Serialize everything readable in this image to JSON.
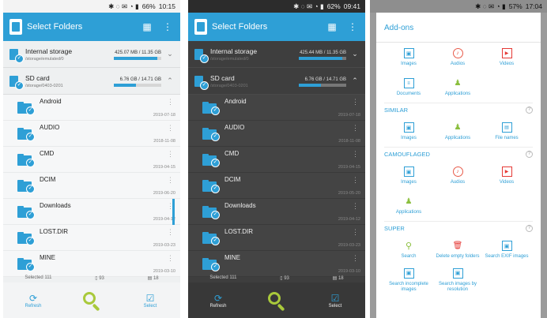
{
  "screen1": {
    "status": {
      "icons": "✱ ◌ ✉ ◔ ▮",
      "battery": "66%",
      "time": "10:15"
    },
    "toolbar": {
      "title": "Select Folders"
    },
    "storages": [
      {
        "name": "Internal storage",
        "path": "/storage/emulated/0",
        "size": "425.07 MB / 11.35 GB",
        "fill": 0.92,
        "chevron": "⌄"
      },
      {
        "name": "SD card",
        "path": "/storage/0403-0201",
        "size": "6.76 GB / 14.71 GB",
        "fill": 0.46,
        "chevron": "⌃"
      }
    ],
    "folders": [
      {
        "name": "Android",
        "date": "2019-07-18"
      },
      {
        "name": "AUDIO",
        "date": "2018-11-08"
      },
      {
        "name": "CMD",
        "date": "2019-04-15"
      },
      {
        "name": "DCIM",
        "date": "2019-06-20"
      },
      {
        "name": "Downloads",
        "date": "2019-04-12"
      },
      {
        "name": "LOST.DIR",
        "date": "2019-03-23"
      },
      {
        "name": "MINE",
        "date": "2019-03-10"
      }
    ],
    "summary": {
      "selected": "Selected 111",
      "files": "93",
      "images": "18"
    },
    "bottom": {
      "refresh": "Refresh",
      "select": "Select"
    }
  },
  "screen2": {
    "status": {
      "icons": "✱ ◌ ✉ ◔ ▮",
      "battery": "62%",
      "time": "09:41"
    },
    "toolbar": {
      "title": "Select Folders"
    },
    "storages": [
      {
        "name": "Internal storage",
        "path": "/storage/emulated/0",
        "size": "425.44 MB / 11.35 GB",
        "fill": 0.92,
        "chevron": "⌄"
      },
      {
        "name": "SD card",
        "path": "/storage/0403-0201",
        "size": "6.76 GB / 14.71 GB",
        "fill": 0.46,
        "chevron": "⌃"
      }
    ],
    "folders": [
      {
        "name": "Android",
        "date": "2019-07-18"
      },
      {
        "name": "AUDIO",
        "date": "2018-11-08"
      },
      {
        "name": "CMD",
        "date": "2019-04-15"
      },
      {
        "name": "DCIM",
        "date": "2019-05-20"
      },
      {
        "name": "Downloads",
        "date": "2019-04-12"
      },
      {
        "name": "LOST.DIR",
        "date": "2019-03-23"
      },
      {
        "name": "MINE",
        "date": "2019-03-10"
      }
    ],
    "summary": {
      "selected": "Selected 111",
      "files": "93",
      "images": "18"
    },
    "bottom": {
      "refresh": "Refresh",
      "select": "Select"
    }
  },
  "screen3": {
    "status": {
      "icons": "✱ ◌ ✉ ◔ ▮",
      "battery": "57%",
      "time": "17:04"
    },
    "title": "Add-ons",
    "top_items": [
      {
        "label": "Images",
        "icon": "image-icon",
        "glyph": "▣",
        "cls": "img"
      },
      {
        "label": "Audios",
        "icon": "audio-icon",
        "glyph": "♪",
        "cls": "aud"
      },
      {
        "label": "Videos",
        "icon": "video-icon",
        "glyph": "▶",
        "cls": "vid"
      },
      {
        "label": "Documents",
        "icon": "document-icon",
        "glyph": "≡",
        "cls": "doc"
      },
      {
        "label": "Applications",
        "icon": "android-icon",
        "glyph": "♟",
        "cls": "app"
      }
    ],
    "sections": [
      {
        "title": "SIMILAR",
        "help": "?",
        "items": [
          {
            "label": "Images",
            "icon": "image-icon",
            "glyph": "▣",
            "cls": "img"
          },
          {
            "label": "Applications",
            "icon": "android-icon",
            "glyph": "♟",
            "cls": "app"
          },
          {
            "label": "File names",
            "icon": "file-icon",
            "glyph": "▤",
            "cls": "fil"
          }
        ]
      },
      {
        "title": "CAMOUFLAGED",
        "help": "?",
        "items": [
          {
            "label": "Images",
            "icon": "image-icon",
            "glyph": "▣",
            "cls": "img"
          },
          {
            "label": "Audios",
            "icon": "audio-icon",
            "glyph": "♪",
            "cls": "aud"
          },
          {
            "label": "Videos",
            "icon": "video-icon",
            "glyph": "▶",
            "cls": "vid"
          },
          {
            "label": "Applications",
            "icon": "android-icon",
            "glyph": "♟",
            "cls": "app"
          }
        ]
      },
      {
        "title": "SUPER",
        "help": "?",
        "items": [
          {
            "label": "Search",
            "icon": "search-icon",
            "glyph": "⚲",
            "cls": "srch"
          },
          {
            "label": "Delete empty folders",
            "icon": "trash-icon",
            "glyph": "🗑",
            "cls": "del"
          },
          {
            "label": "Search EXIF images",
            "icon": "exif-icon",
            "glyph": "▣",
            "cls": "exif"
          },
          {
            "label": "Search incomplete images",
            "icon": "image-icon",
            "glyph": "▣",
            "cls": "img"
          },
          {
            "label": "Search images by resolution",
            "icon": "image-icon",
            "glyph": "▣",
            "cls": "img"
          }
        ]
      }
    ]
  },
  "colors": {
    "accent": "#2e9fd6",
    "green": "#a9c93b",
    "red": "#e53935"
  }
}
